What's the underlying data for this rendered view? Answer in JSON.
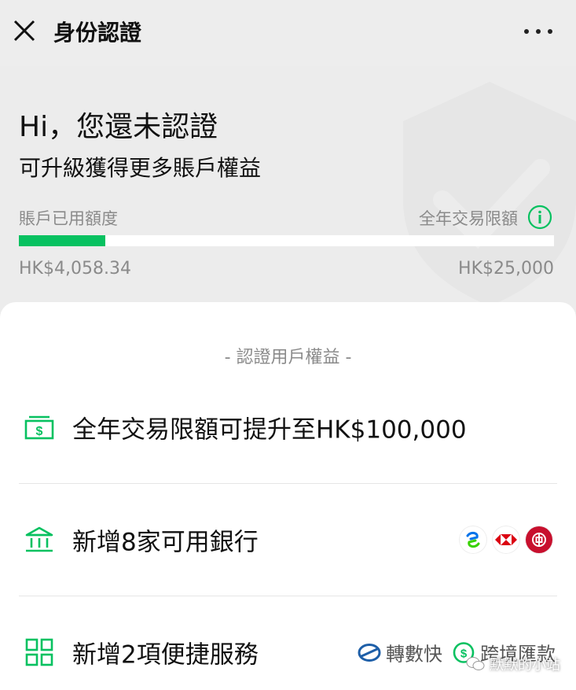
{
  "nav": {
    "title": "身份認證"
  },
  "header": {
    "title": "Hi，您還未認證",
    "subtitle": "可升級獲得更多賬戶權益",
    "used_label": "賬戶已用額度",
    "limit_label": "全年交易限額",
    "used_amount": "HK$4,058.34",
    "limit_amount": "HK$25,000",
    "progress_fraction": 0.162
  },
  "benefits": {
    "heading": "- 認證用戶權益 -",
    "items": [
      {
        "label": "全年交易限額可提升至HK$100,000",
        "icon": "money-icon"
      },
      {
        "label": "新增8家可用銀行",
        "icon": "bank-icon"
      },
      {
        "label": "新增2項便捷服務",
        "icon": "grid-icon"
      }
    ],
    "services": [
      {
        "label": "轉數快",
        "icon": "fps-icon"
      },
      {
        "label": "跨境匯款",
        "icon": "remittance-icon"
      }
    ]
  },
  "watermark": {
    "text": "默默的小站"
  },
  "colors": {
    "accent": "#07c160",
    "background": "#ededed"
  }
}
